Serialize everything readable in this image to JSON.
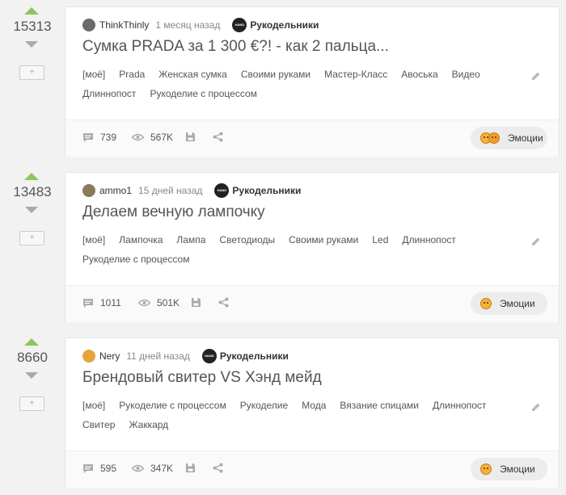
{
  "posts": [
    {
      "rating": "15313",
      "author": "ThinkThinly",
      "time": "1 месяц назад",
      "community": "Рукодельники",
      "community_logo_text": "HAND MADE",
      "title": "Сумка PRADA за 1 300 €?! - как 2 пальца...",
      "tags": [
        "[моё]",
        "Prada",
        "Женская сумка",
        "Своими руками",
        "Мастер-Класс",
        "Авоська",
        "Видео",
        "Длиннопост",
        "Рукоделие с процессом"
      ],
      "comments": "739",
      "views": "567K",
      "emotions_label": "Эмоции",
      "avatar_color": "#6b6b6b"
    },
    {
      "rating": "13483",
      "author": "ammo1",
      "time": "15 дней назад",
      "community": "Рукодельники",
      "community_logo_text": "HAND MADE",
      "title": "Делаем вечную лампочку",
      "tags": [
        "[моё]",
        "Лампочка",
        "Лампа",
        "Светодиоды",
        "Своими руками",
        "Led",
        "Длиннопост",
        "Рукоделие с процессом"
      ],
      "comments": "1011",
      "views": "501K",
      "emotions_label": "Эмоции",
      "avatar_color": "#8a7a5c"
    },
    {
      "rating": "8660",
      "author": "Nery",
      "time": "11 дней назад",
      "community": "Рукодельники",
      "community_logo_text": "HAND MADE",
      "title": "Брендовый свитер VS Хэнд мейд",
      "tags": [
        "[моё]",
        "Рукоделие с процессом",
        "Рукоделие",
        "Мода",
        "Вязание спицами",
        "Длиннопост",
        "Свитер",
        "Жаккард"
      ],
      "comments": "595",
      "views": "347K",
      "emotions_label": "Эмоции",
      "avatar_color": "#e6a53a"
    }
  ],
  "plus_label": "+"
}
